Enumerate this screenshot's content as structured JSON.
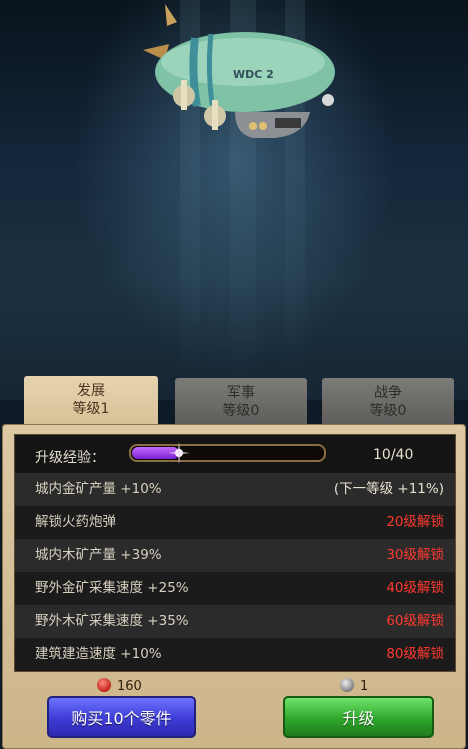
{
  "tabs": [
    {
      "name": "发展",
      "level": "等级1",
      "active": true
    },
    {
      "name": "军事",
      "level": "等级0",
      "active": false
    },
    {
      "name": "战争",
      "level": "等级0",
      "active": false
    }
  ],
  "exp": {
    "label": "升级经验：",
    "value": "10/40",
    "current": 10,
    "max": 40
  },
  "bonuses": [
    {
      "text": "城内金矿产量 +10%",
      "status": "(下一等级 +11%)"
    },
    {
      "text": "解锁火药炮弹",
      "status": "20级解锁"
    },
    {
      "text": "城内木矿产量 +39%",
      "status": "30级解锁"
    },
    {
      "text": "野外金矿采集速度 +25%",
      "status": "40级解锁"
    },
    {
      "text": "野外木矿采集速度 +35%",
      "status": "60级解锁"
    },
    {
      "text": "建筑建造速度 +10%",
      "status": "80级解锁"
    }
  ],
  "costs": {
    "gems": "160",
    "parts": "1"
  },
  "buttons": {
    "buy": "购买10个零件",
    "upgrade": "升级"
  },
  "airship_text": "WDC 2",
  "colors": {
    "locked": "#ff3a2f",
    "exp_fill": "#9b3cf0",
    "buy": "#3d3bd6",
    "upgrade": "#2fa72b"
  }
}
